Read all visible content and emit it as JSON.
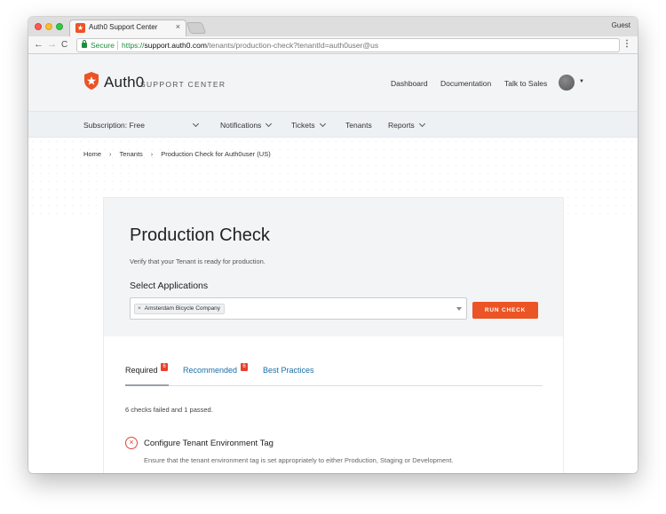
{
  "browser": {
    "tab_title": "Auth0 Support Center",
    "tab_close": "×",
    "profile": "Guest",
    "back": "←",
    "forward": "→",
    "reload": "C",
    "secure_label": "Secure",
    "url_scheme": "https://",
    "url_host": "support.auth0.com",
    "url_path": "/tenants/production-check?tenantId=auth0user@us",
    "menu": "⋮"
  },
  "header": {
    "logo_text": "Auth0",
    "logo_sub": "SUPPORT CENTER",
    "nav": [
      "Dashboard",
      "Documentation",
      "Talk to Sales"
    ],
    "avatar_caret": "▼"
  },
  "subnav": {
    "subscription_label": "Subscription:",
    "subscription_value": "Free",
    "items": [
      "Notifications",
      "Tickets",
      "Tenants",
      "Reports"
    ]
  },
  "breadcrumb": {
    "items": [
      "Home",
      "Tenants",
      "Production Check for Auth0user (US)"
    ],
    "separator": "›"
  },
  "main": {
    "title": "Production Check",
    "description": "Verify that your Tenant is ready for production.",
    "select_label": "Select Applications",
    "chip_x": "×",
    "selected_app": "Amsterdam Bicycle Company",
    "run_button": "RUN CHECK",
    "tabs": [
      {
        "label": "Required",
        "badge": "6"
      },
      {
        "label": "Recommended",
        "badge": "6"
      },
      {
        "label": "Best Practices",
        "badge": ""
      }
    ],
    "summary": "6 checks failed and 1 passed.",
    "checks": [
      {
        "icon": "×",
        "title": "Configure Tenant Environment Tag",
        "description": "Ensure that the tenant environment tag is set appropriately to either Production, Staging or Development."
      }
    ]
  },
  "colors": {
    "accent": "#eb5424",
    "link": "#1a6fa8",
    "error": "#e0453a"
  }
}
